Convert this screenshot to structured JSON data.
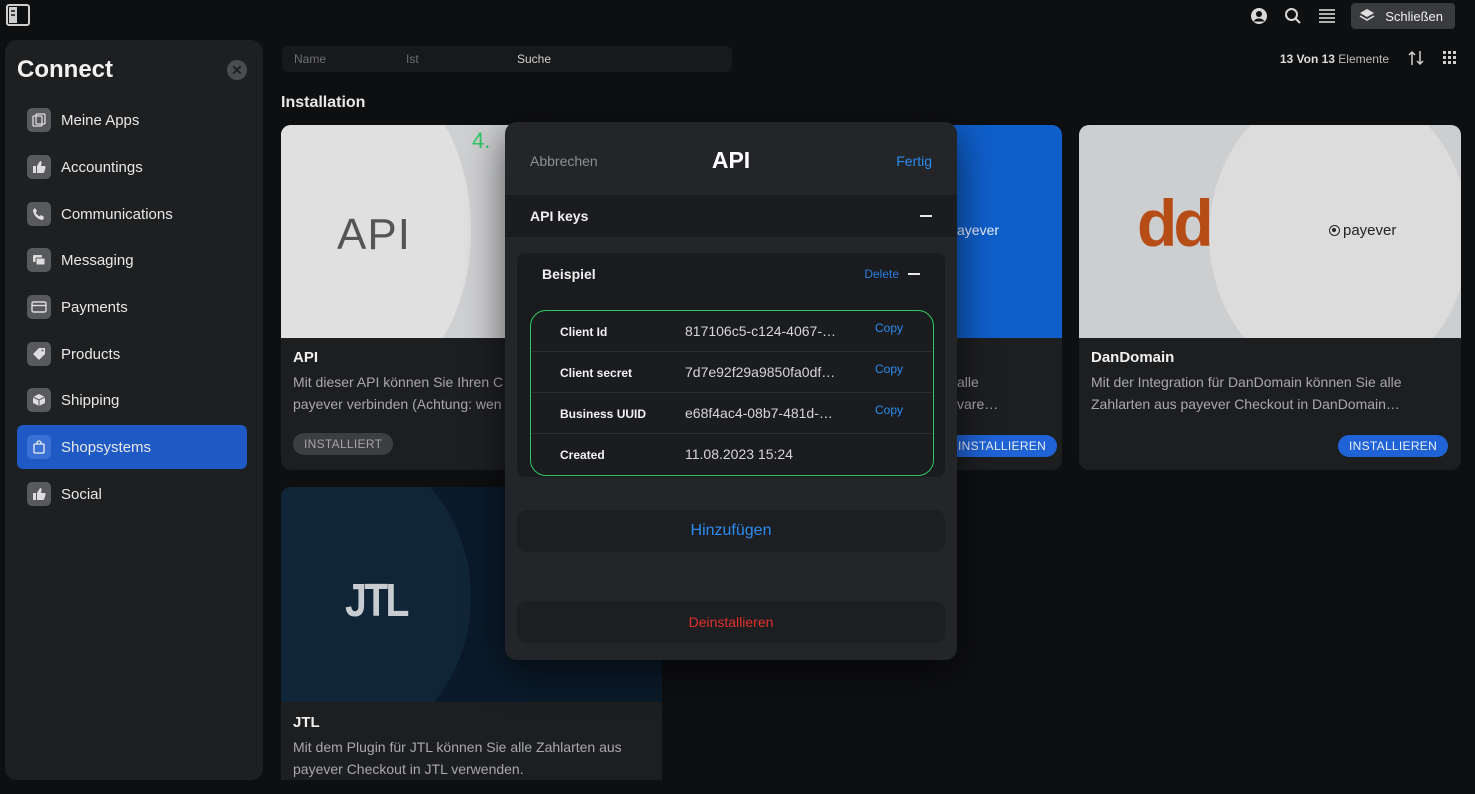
{
  "topbar": {
    "close_label": "Schließen",
    "icons": [
      "sidebar-toggle-icon",
      "account-icon",
      "search-icon",
      "menu-icon",
      "layers-icon"
    ]
  },
  "sidebar": {
    "title": "Connect",
    "items": [
      {
        "label": "Meine Apps",
        "icon": "apps-icon"
      },
      {
        "label": "Accountings",
        "icon": "thumbs-up-icon"
      },
      {
        "label": "Communications",
        "icon": "phone-icon"
      },
      {
        "label": "Messaging",
        "icon": "chat-icon"
      },
      {
        "label": "Payments",
        "icon": "card-icon"
      },
      {
        "label": "Products",
        "icon": "tag-icon"
      },
      {
        "label": "Shipping",
        "icon": "box-icon"
      },
      {
        "label": "Shopsystems",
        "icon": "bag-icon",
        "active": true
      },
      {
        "label": "Social",
        "icon": "thumbs-up-icon"
      }
    ]
  },
  "search": {
    "col_name": "Name",
    "col_ist": "Ist",
    "col_search": "Suche"
  },
  "list_meta": {
    "count": "13 Von 13",
    "unit": "Elemente"
  },
  "section_title": "Installation",
  "cards": {
    "api": {
      "logo": "API",
      "title": "API",
      "desc1": "Mit dieser API können Sie Ihren C",
      "desc2": "payever verbinden (Achtung: wen",
      "status": "INSTALLIERT"
    },
    "payever_partial": {
      "logo_text": "ayever",
      "desc1": "alle",
      "desc2": "vare…",
      "status": "INSTALLIEREN"
    },
    "dandomain": {
      "logo": "dd",
      "logo_brand": "payever",
      "title": "DanDomain",
      "desc1": "Mit der Integration für DanDomain können Sie alle",
      "desc2": "Zahlarten aus payever Checkout in DanDomain…",
      "status": "INSTALLIEREN"
    },
    "jtl": {
      "logo": "JTL",
      "title": "JTL",
      "desc1": "Mit dem Plugin für JTL können Sie alle Zahlarten aus",
      "desc2": "payever Checkout in JTL verwenden."
    }
  },
  "step_marker": "4.",
  "modal": {
    "cancel": "Abbrechen",
    "title": "API",
    "done": "Fertig",
    "section_label": "API keys",
    "group_label": "Beispiel",
    "delete_label": "Delete",
    "rows": [
      {
        "key": "Client Id",
        "value": "817106c5-c124-4067-…",
        "copy": "Copy"
      },
      {
        "key": "Client secret",
        "value": "7d7e92f29a9850fa0df…",
        "copy": "Copy"
      },
      {
        "key": "Business UUID",
        "value": "e68f4ac4-08b7-481d-…",
        "copy": "Copy"
      },
      {
        "key": "Created",
        "value": "11.08.2023 15:24"
      }
    ],
    "add_label": "Hinzufügen",
    "uninstall_label": "Deinstallieren"
  },
  "colors": {
    "accent": "#2a8cf0",
    "active": "#1f59c4",
    "danger": "#e0312c",
    "highlight": "#2ec964"
  }
}
